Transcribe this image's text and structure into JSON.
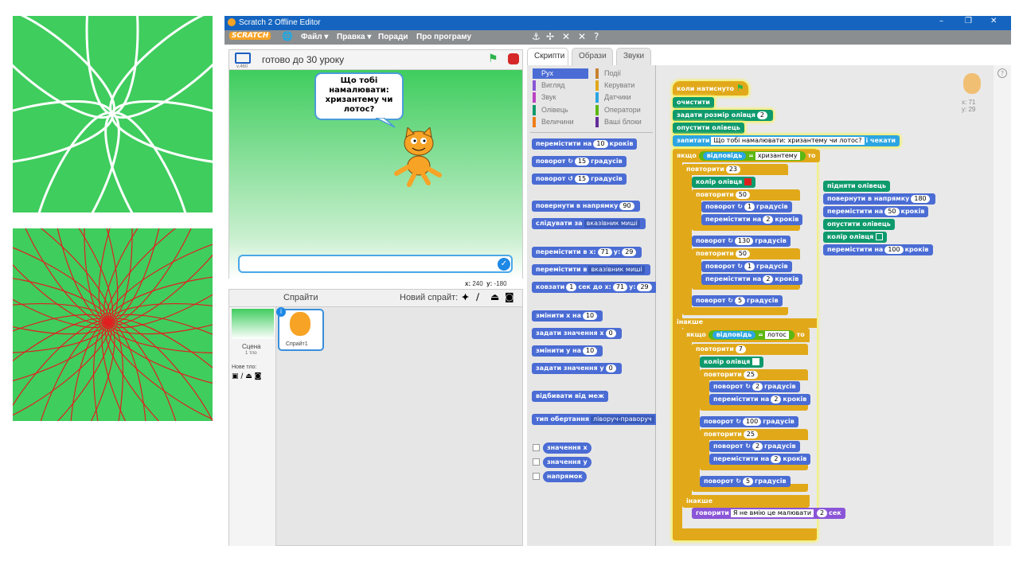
{
  "window": {
    "title": "Scratch 2 Offline Editor",
    "logo": "SCRATCH"
  },
  "menu": {
    "file": "Файл ▾",
    "edit": "Правка ▾",
    "tips": "Поради",
    "about": "Про програму"
  },
  "stage": {
    "title": "готово до 30 уроку",
    "version": "v.460",
    "bubble": "Що тобі намалювати: хризантему чи лотос?",
    "coords_x_label": "x:",
    "coords_x": "240",
    "coords_y_label": "y:",
    "coords_y": "-180"
  },
  "sprites": {
    "header": "Спрайти",
    "new_sprite": "Новий спрайт:",
    "stage_label": "Сцена",
    "stage_sub": "1 тло",
    "new_bg": "Нове тло:",
    "sprite1": "Спрайт1"
  },
  "tabs": {
    "scripts": "Скрипти",
    "costumes": "Образи",
    "sounds": "Звуки"
  },
  "categories": {
    "motion": "Рух",
    "looks": "Вигляд",
    "sound": "Звук",
    "pen": "Олівець",
    "data": "Величини",
    "events": "Події",
    "control": "Керувати",
    "sensing": "Датчики",
    "operators": "Оператори",
    "more": "Ваші блоки"
  },
  "palette": {
    "move": "перемістити на",
    "move_n": "10",
    "move_s": "кроків",
    "turn": "поворот",
    "turn_n": "15",
    "deg": "градусів",
    "point": "повернути в напрямку",
    "point_n": "90",
    "follow": "слідувати за",
    "follow_v": "вказівник миші",
    "gotoxy": "перемістити в x:",
    "gx": "71",
    "gy_label": "y:",
    "gy": "29",
    "goto": "перемістити в",
    "goto_v": "вказівник миші",
    "glide": "ковзати",
    "glide_n": "1",
    "glide_s": "сек до x:",
    "glide_x": "71",
    "glide_y_label": "y:",
    "glide_y": "29",
    "changex": "змінити х на",
    "changex_n": "10",
    "setx": "задати значення х",
    "setx_n": "0",
    "changey": "змінити у на",
    "changey_n": "10",
    "sety": "задати значення у",
    "sety_n": "0",
    "bounce": "відбивати від меж",
    "rotstyle": "тип обертання",
    "rotstyle_v": "ліворуч-праворуч",
    "xpos": "значення х",
    "ypos": "значення у",
    "dir": "напрямок"
  },
  "script": {
    "hat": "коли натиснуто",
    "clear": "очистити",
    "pensize": "задати розмір олівця",
    "pensize_n": "2",
    "pendown": "опустити олівець",
    "ask": "запитати",
    "ask_v": "Що тобі намалювати: хризантему чи лотос?",
    "ask_wait": "і чекати",
    "if": "якщо",
    "answer": "відповідь",
    "eq": "=",
    "chrys": "хризантему",
    "then": "то",
    "rep1": "повторити",
    "rep1_n": "23",
    "color": "колір олівця",
    "rep2_n": "50",
    "turn1": "поворот",
    "turn1_n": "1",
    "deg": "градусів",
    "move": "перемістити на",
    "move_n": "2",
    "steps": "кроків",
    "turn130": "130",
    "rep3_n": "50",
    "turn5": "5",
    "else": "інакше",
    "lotus": "лотос",
    "rep4_n": "7",
    "rep5_n": "25",
    "turn2": "2",
    "turn100": "100",
    "rep6_n": "25",
    "say": "говорити",
    "say_v": "Я не вмію це малювати",
    "say_n": "2",
    "sec": "сек",
    "penup": "підняти олівець",
    "point180": "повернути в напрямку",
    "point180_n": "180",
    "move50_n": "50",
    "pendown2": "опустити олівець",
    "color2": "колір олівця",
    "move100_n": "100",
    "sprite_x_label": "x:",
    "sprite_x": "71",
    "sprite_y_label": "y:",
    "sprite_y": "29"
  },
  "colors": {
    "accent": "#1565c0",
    "stage_green": "#3fcd5e",
    "pen_red": "#e02020"
  }
}
